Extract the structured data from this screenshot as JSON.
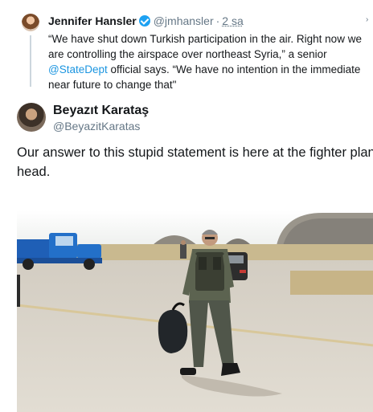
{
  "quoted_tweet": {
    "name": "Jennifer Hansler",
    "handle": "@jmhansler",
    "separator": "·",
    "time": "2 sa",
    "chevron": "›",
    "text_lines": [
      "“We have shut down Turkish participation in the air. Right now we",
      "are controlling the airspace over northeast Syria,” a senior",
      "official says. “We have no intention in the immediate",
      "near future to change that\""
    ],
    "mention": "@StateDept"
  },
  "tweet": {
    "name": "Beyazıt Karataş",
    "handle": "@BeyazitKaratas",
    "text_lines": [
      "Our answer to this stupid statement is here at the fighter plane",
      "head."
    ]
  },
  "icons": {
    "verified": "verified-badge-icon",
    "more": "chevron-icon"
  },
  "colors": {
    "link": "#1b95e0",
    "verified": "#1da1f2",
    "secondary_text": "#657786",
    "thread_line": "#ccd6dd"
  }
}
